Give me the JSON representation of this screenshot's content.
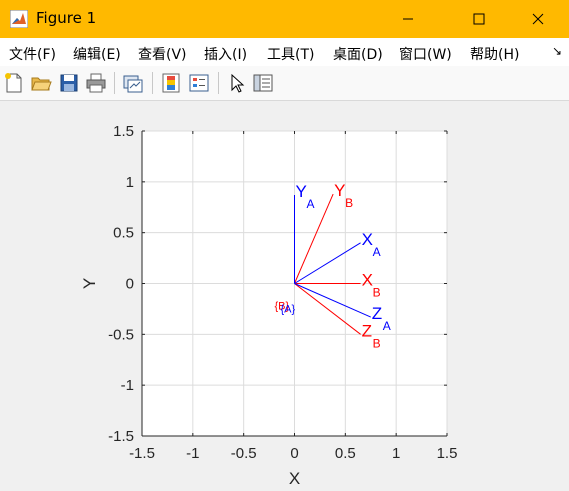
{
  "window": {
    "title": "Figure 1",
    "colors": {
      "titlebar": "#ffb900",
      "menubar": "#ffffff",
      "toolbar": "#f9f9f9",
      "figure_bg": "#f0f0f0"
    }
  },
  "menu": {
    "items": [
      "文件(F)",
      "编辑(E)",
      "查看(V)",
      "插入(I)",
      "工具(T)",
      "桌面(D)",
      "窗口(W)",
      "帮助(H)"
    ]
  },
  "toolbar": {
    "icons": [
      "new-figure-icon",
      "open-file-icon",
      "save-icon",
      "print-icon",
      "link-plot-icon",
      "insert-colorbar-icon",
      "insert-legend-icon",
      "pointer-icon",
      "property-inspector-icon"
    ]
  },
  "chart_data": {
    "type": "line",
    "xlabel": "X",
    "ylabel": "Y",
    "xlim": [
      -1.5,
      1.5
    ],
    "ylim": [
      -1.5,
      1.5
    ],
    "xticks": [
      "-1.5",
      "-1",
      "-0.5",
      "0",
      "0.5",
      "1",
      "1.5"
    ],
    "yticks": [
      "1.5",
      "1",
      "0.5",
      "0",
      "-0.5",
      "-1",
      "-1.5"
    ],
    "grid": true,
    "series": [
      {
        "name": "A",
        "color": "#0000ff",
        "origin_label": "{A}",
        "axes": [
          {
            "label": "X",
            "sub": "A",
            "end": [
              0.65,
              0.4
            ]
          },
          {
            "label": "Y",
            "sub": "A",
            "end": [
              0.0,
              0.87
            ]
          },
          {
            "label": "Z",
            "sub": "A",
            "end": [
              0.75,
              -0.33
            ]
          }
        ]
      },
      {
        "name": "B",
        "color": "#ff0000",
        "origin_label": "{B}",
        "axes": [
          {
            "label": "X",
            "sub": "B",
            "end": [
              0.65,
              0.0
            ]
          },
          {
            "label": "Y",
            "sub": "B",
            "end": [
              0.38,
              0.88
            ]
          },
          {
            "label": "Z",
            "sub": "B",
            "end": [
              0.65,
              -0.5
            ]
          }
        ]
      }
    ]
  }
}
